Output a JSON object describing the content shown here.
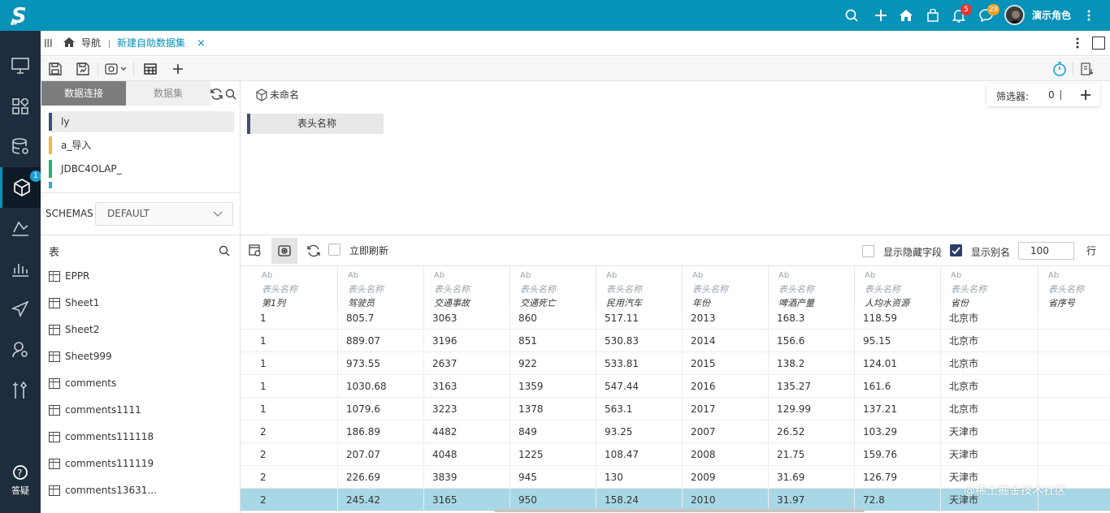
{
  "topbar": {
    "user": "演示角色",
    "bell_badge": "5",
    "msg_badge": "28",
    "bell_color": "#e8382f",
    "msg_color": "#f0a020"
  },
  "rail": {
    "badge": "1",
    "help_label": "答疑"
  },
  "tabs": {
    "nav_label": "导航",
    "active_tab": "新建自助数据集"
  },
  "left": {
    "seg_connect": "数据连接",
    "seg_dataset": "数据集",
    "connections": [
      {
        "label": "ly",
        "color": "#3d4f74"
      },
      {
        "label": "a_导入",
        "color": "#f6b63c"
      },
      {
        "label": "JDBC4OLAP_",
        "color": "#26b36b"
      },
      {
        "label": "",
        "color": "#2fa8de"
      }
    ],
    "schema_label": "SCHEMAS",
    "schema_value": "DEFAULT",
    "tables_title": "表",
    "tables": [
      "EPPR",
      "Sheet1",
      "Sheet2",
      "Sheet999",
      "comments",
      "comments1111",
      "comments111118",
      "comments111119",
      "comments13631..."
    ]
  },
  "design": {
    "node_name": "未命名",
    "filter_label": "筛选器:",
    "filter_count": "0",
    "header_chip": "表头名称"
  },
  "preview": {
    "refresh_label": "立即刷新",
    "show_hidden_label": "显示隐藏字段",
    "show_alias_label": "显示别名",
    "rows_value": "100",
    "rows_unit": "行"
  },
  "grid": {
    "type_badge": "Ab",
    "columns": [
      {
        "alias": "表头名称",
        "name": "第1列"
      },
      {
        "alias": "表头名称",
        "name": "驾驶员"
      },
      {
        "alias": "表头名称",
        "name": "交通事故"
      },
      {
        "alias": "表头名称",
        "name": "交通死亡"
      },
      {
        "alias": "表头名称",
        "name": "民用汽车"
      },
      {
        "alias": "表头名称",
        "name": "年份"
      },
      {
        "alias": "表头名称",
        "name": "啤酒产量"
      },
      {
        "alias": "表头名称",
        "name": "人均水资源"
      },
      {
        "alias": "表头名称",
        "name": "省份"
      },
      {
        "alias": "表头名称",
        "name": "省序号"
      }
    ],
    "rows": [
      [
        "1",
        "805.7",
        "3063",
        "860",
        "517.11",
        "2013",
        "168.3",
        "118.59",
        "北京市",
        ""
      ],
      [
        "1",
        "889.07",
        "3196",
        "851",
        "530.83",
        "2014",
        "156.6",
        "95.15",
        "北京市",
        ""
      ],
      [
        "1",
        "973.55",
        "2637",
        "922",
        "533.81",
        "2015",
        "138.2",
        "124.01",
        "北京市",
        ""
      ],
      [
        "1",
        "1030.68",
        "3163",
        "1359",
        "547.44",
        "2016",
        "135.27",
        "161.6",
        "北京市",
        ""
      ],
      [
        "1",
        "1079.6",
        "3223",
        "1378",
        "563.1",
        "2017",
        "129.99",
        "137.21",
        "北京市",
        ""
      ],
      [
        "2",
        "186.89",
        "4482",
        "849",
        "93.25",
        "2007",
        "26.52",
        "103.29",
        "天津市",
        ""
      ],
      [
        "2",
        "207.07",
        "4048",
        "1225",
        "108.47",
        "2008",
        "21.75",
        "159.76",
        "天津市",
        ""
      ],
      [
        "2",
        "226.69",
        "3839",
        "945",
        "130",
        "2009",
        "31.69",
        "126.79",
        "天津市",
        ""
      ],
      [
        "2",
        "245.42",
        "3165",
        "950",
        "158.24",
        "2010",
        "31.97",
        "72.8",
        "天津市",
        ""
      ]
    ]
  },
  "watermark": "@稀土掘金技术社区"
}
